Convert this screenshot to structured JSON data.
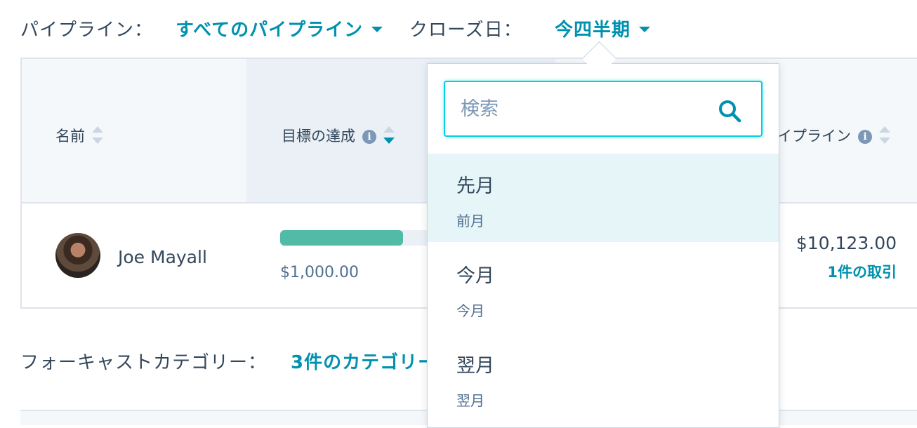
{
  "filters": {
    "pipeline_label": "パイプライン：",
    "pipeline_value": "すべてのパイプライン",
    "close_date_label": "クローズ日：",
    "close_date_value": "今四半期"
  },
  "table": {
    "columns": {
      "name": "名前",
      "goal": "目標の達成",
      "pipeline": "イプライン"
    },
    "rows": [
      {
        "name": "Joe Mayall",
        "goal_amount": "$1,000.00",
        "goal_progress_fraction": 0.7,
        "pipeline_amount": "$10,123.00",
        "deals_link": "1件の取引"
      }
    ]
  },
  "forecast": {
    "category_label": "フォーキャストカテゴリー：",
    "category_value": "3件のカテゴリー"
  },
  "dropdown": {
    "search_placeholder": "検索",
    "options": [
      {
        "title": "先月",
        "subtitle": "前月",
        "highlighted": true
      },
      {
        "title": "今月",
        "subtitle": "今月",
        "highlighted": false
      },
      {
        "title": "翌月",
        "subtitle": "翌月",
        "highlighted": false
      }
    ]
  },
  "colors": {
    "accent": "#0091ae",
    "progress": "#51bba7",
    "text": "#33475b",
    "focus": "#00d0e4",
    "highlight": "#e5f5f8"
  }
}
